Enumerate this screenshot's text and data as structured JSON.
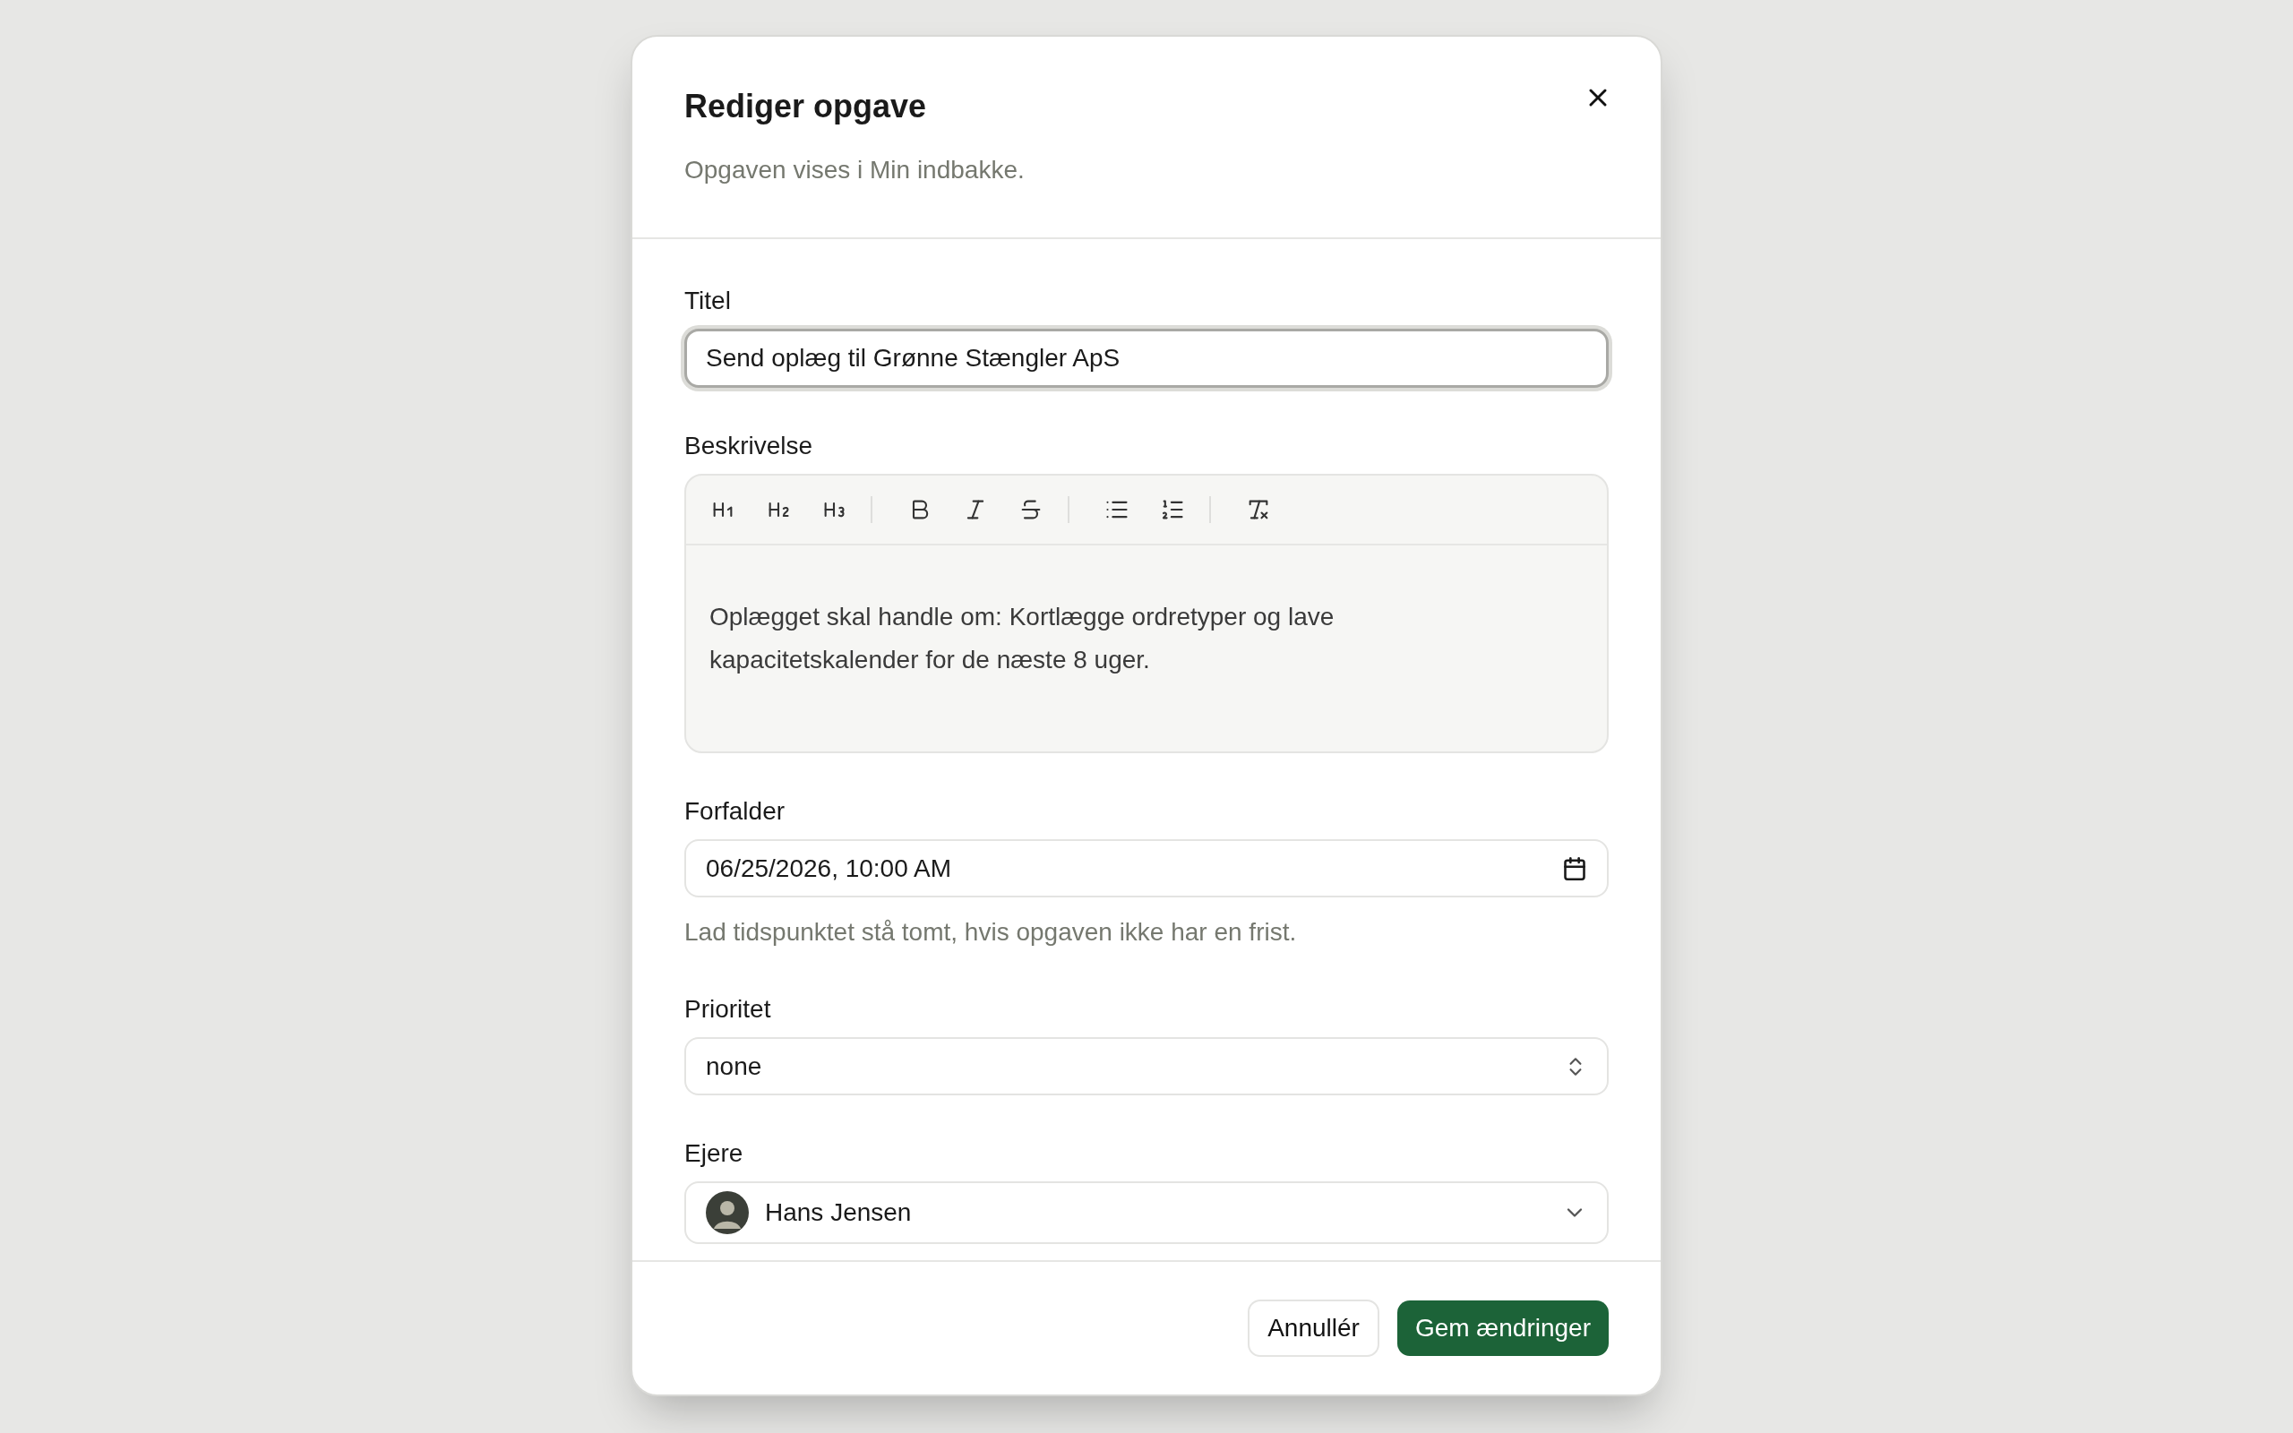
{
  "dialog": {
    "title": "Rediger opgave",
    "subtitle": "Opgaven vises i Min indbakke."
  },
  "fields": [
    {
      "kind": "text",
      "label": "Titel",
      "value": "Send oplæg til Grønne Stængler ApS",
      "focused": true
    },
    {
      "kind": "rich_text",
      "label": "Beskrivelse",
      "value": "Oplægget skal handle om: Kortlægge ordretyper og lave kapacitetskalender for de næste 8 uger."
    },
    {
      "kind": "datetime",
      "label": "Forfalder",
      "value": "06/25/2026, 10:00 AM",
      "help": "Lad tidspunktet stå tomt, hvis opgaven ikke har en frist."
    },
    {
      "kind": "select",
      "label": "Prioritet",
      "value": "none"
    },
    {
      "kind": "owner_select",
      "label": "Ejere",
      "value": "Hans Jensen"
    }
  ],
  "buttons": [
    {
      "kind": "secondary",
      "label": "Annullér"
    },
    {
      "kind": "primary",
      "label": "Gem ændringer"
    }
  ]
}
